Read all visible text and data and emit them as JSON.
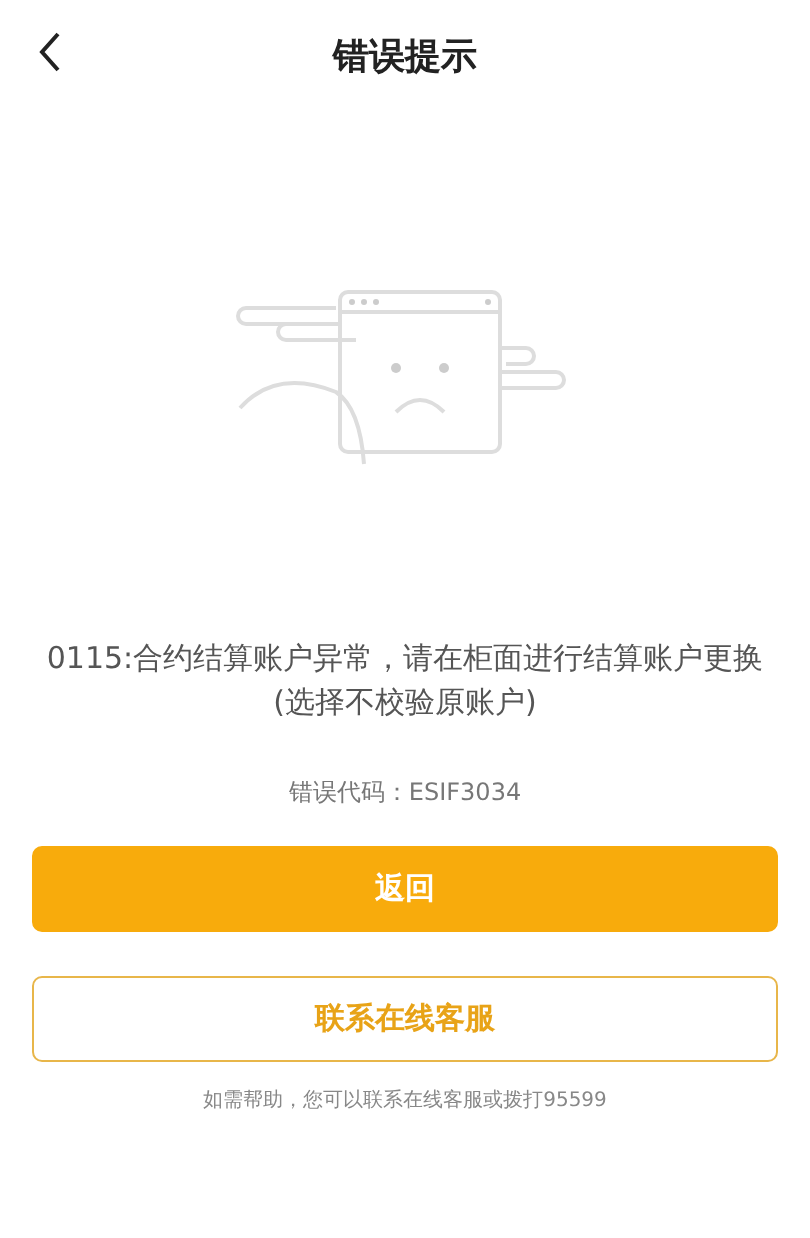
{
  "header": {
    "title": "错误提示"
  },
  "error": {
    "message": "0115:合约结算账户异常，请在柜面进行结算账户更换\n(选择不校验原账户)",
    "code": "错误代码：ESIF3034"
  },
  "buttons": [
    {
      "kind": "primary",
      "label": "返回"
    },
    {
      "kind": "outline",
      "label": "联系在线客服"
    }
  ],
  "help": "如需帮助，您可以联系在线客服或拨打95599"
}
